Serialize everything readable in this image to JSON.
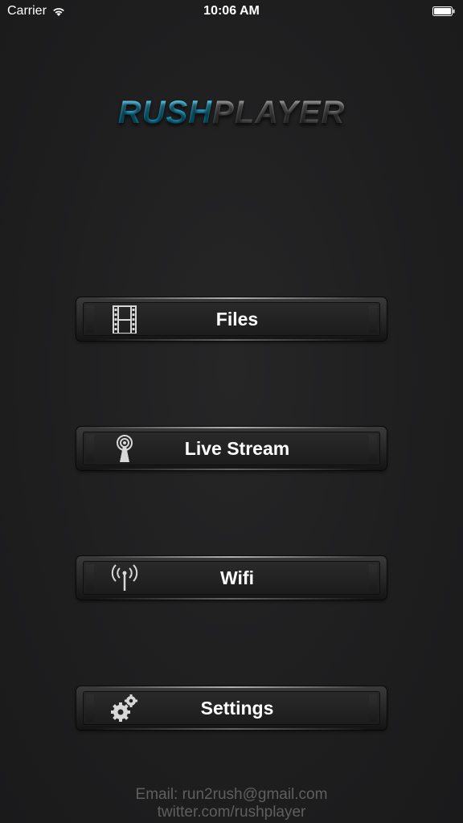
{
  "status_bar": {
    "carrier": "Carrier",
    "time": "10:06 AM",
    "wifi_icon": "wifi-signal-icon",
    "battery_icon": "battery-full-icon"
  },
  "logo": {
    "part1": "RUSH",
    "part2": "PLAYER",
    "part1_color": "#2bb8de",
    "part2_color": "#7a7a7a"
  },
  "menu": {
    "items": [
      {
        "label": "Files",
        "icon": "film-strip-icon"
      },
      {
        "label": "Live Stream",
        "icon": "broadcast-antenna-icon"
      },
      {
        "label": "Wifi",
        "icon": "wifi-antenna-icon"
      },
      {
        "label": "Settings",
        "icon": "gears-icon"
      }
    ]
  },
  "footer": {
    "email": "Email: run2rush@gmail.com",
    "twitter": "twitter.com/rushplayer"
  },
  "colors": {
    "background": "#1f1f20",
    "label": "#ffffff",
    "footer_text": "#5f5f60"
  }
}
